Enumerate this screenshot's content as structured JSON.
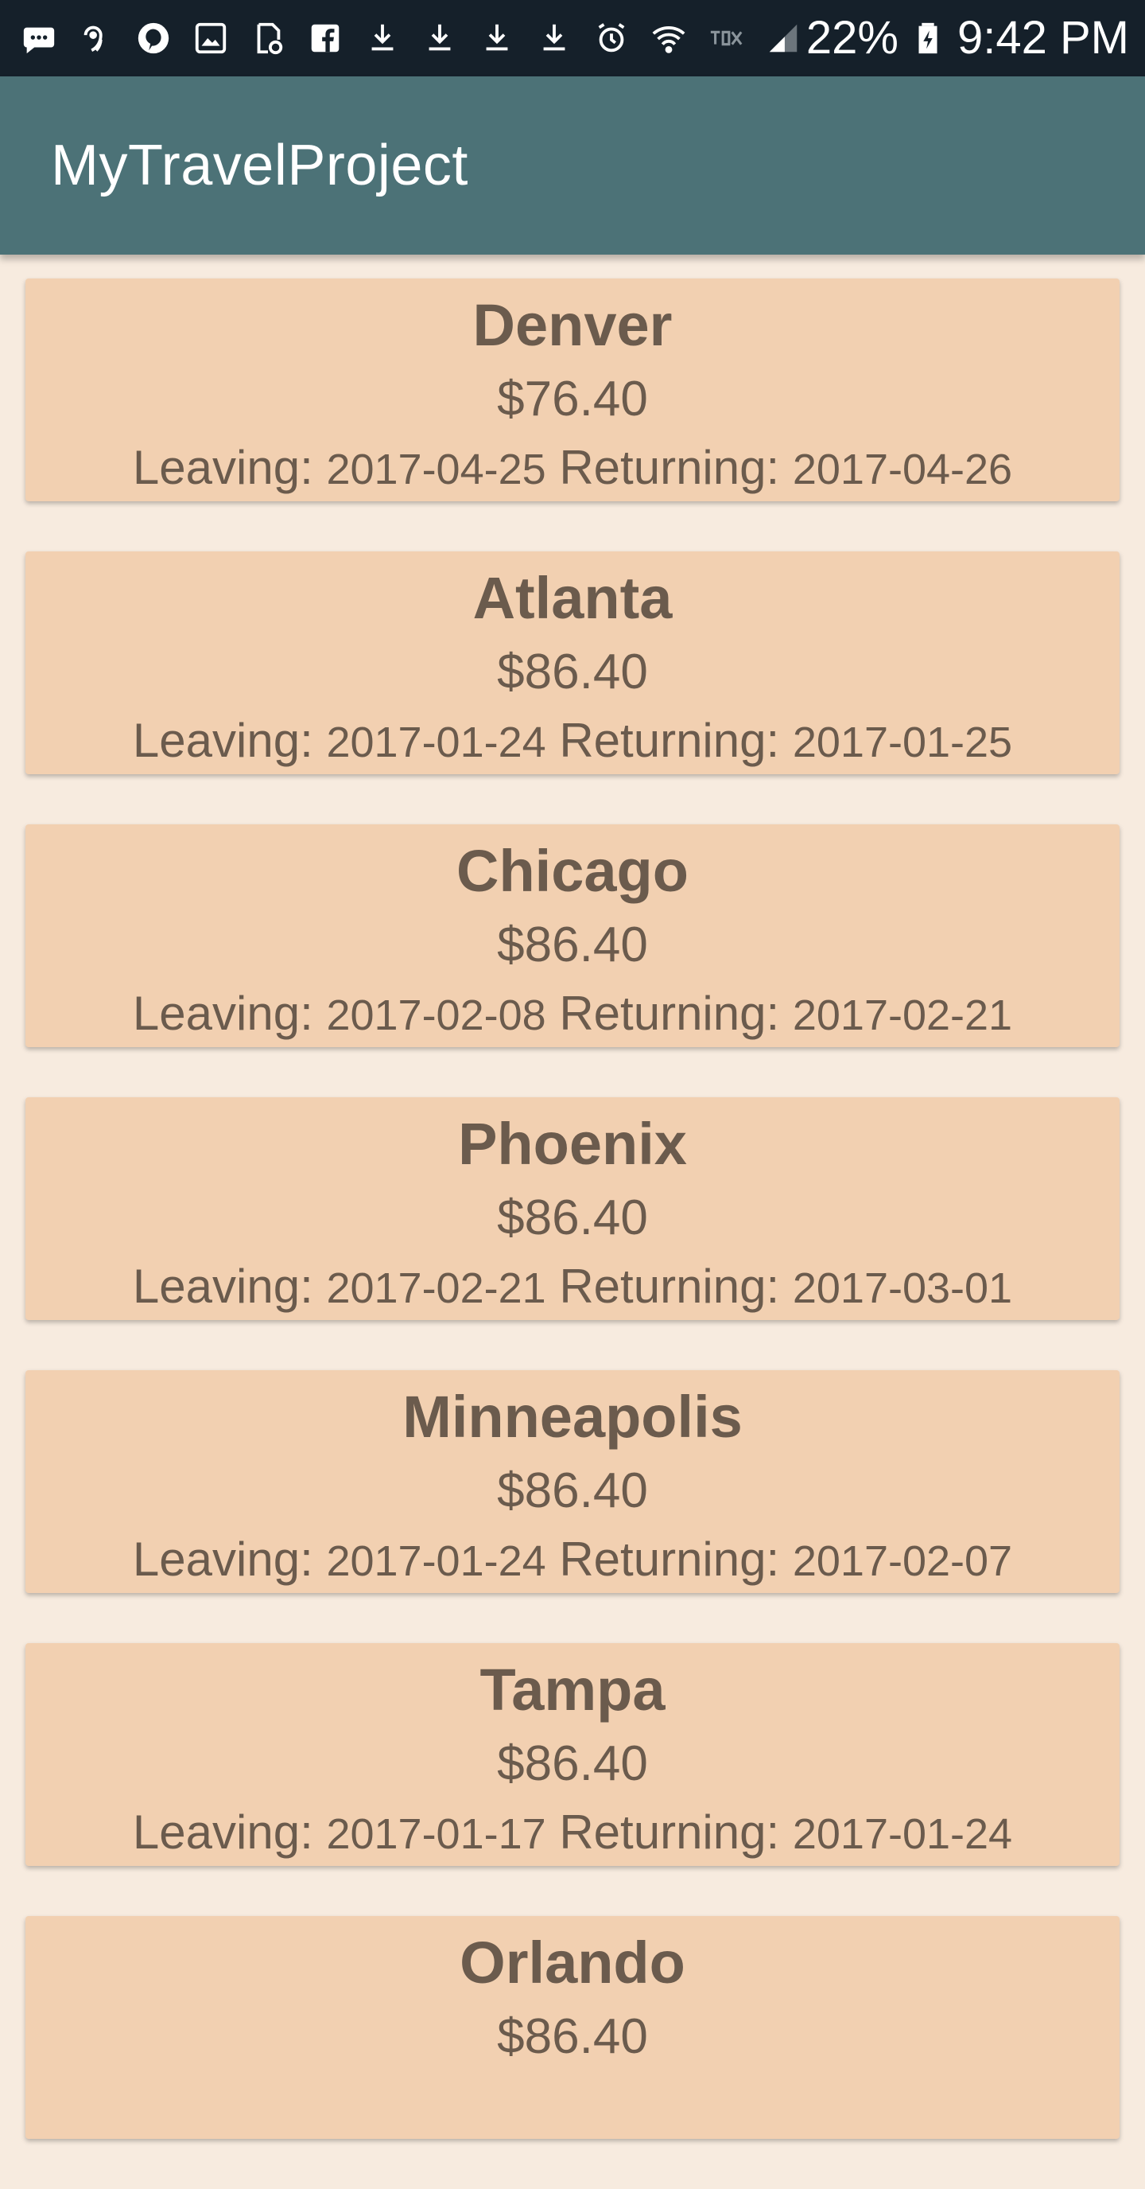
{
  "status_bar": {
    "icons": [
      "messages-icon",
      "hotspot-icon",
      "pinterest-icon",
      "gallery-icon",
      "sync-icon",
      "facebook-icon",
      "download-icon",
      "download-icon",
      "download-icon",
      "download-icon",
      "alarm-icon",
      "wifi-icon",
      "roaming-icon",
      "signal-icon"
    ],
    "battery_percent": "22%",
    "time": "9:42 PM"
  },
  "app_bar": {
    "title": "MyTravelProject"
  },
  "trip_labels": {
    "leaving": "Leaving:",
    "returning": "Returning:"
  },
  "trips": [
    {
      "city": "Denver",
      "price": "$76.40",
      "leaving": "2017-04-25",
      "returning": "2017-04-26"
    },
    {
      "city": "Atlanta",
      "price": "$86.40",
      "leaving": "2017-01-24",
      "returning": "2017-01-25"
    },
    {
      "city": "Chicago",
      "price": "$86.40",
      "leaving": "2017-02-08",
      "returning": "2017-02-21"
    },
    {
      "city": "Phoenix",
      "price": "$86.40",
      "leaving": "2017-02-21",
      "returning": "2017-03-01"
    },
    {
      "city": "Minneapolis",
      "price": "$86.40",
      "leaving": "2017-01-24",
      "returning": "2017-02-07"
    },
    {
      "city": "Tampa",
      "price": "$86.40",
      "leaving": "2017-01-17",
      "returning": "2017-01-24"
    },
    {
      "city": "Orlando",
      "price": "$86.40",
      "leaving": "",
      "returning": ""
    }
  ]
}
